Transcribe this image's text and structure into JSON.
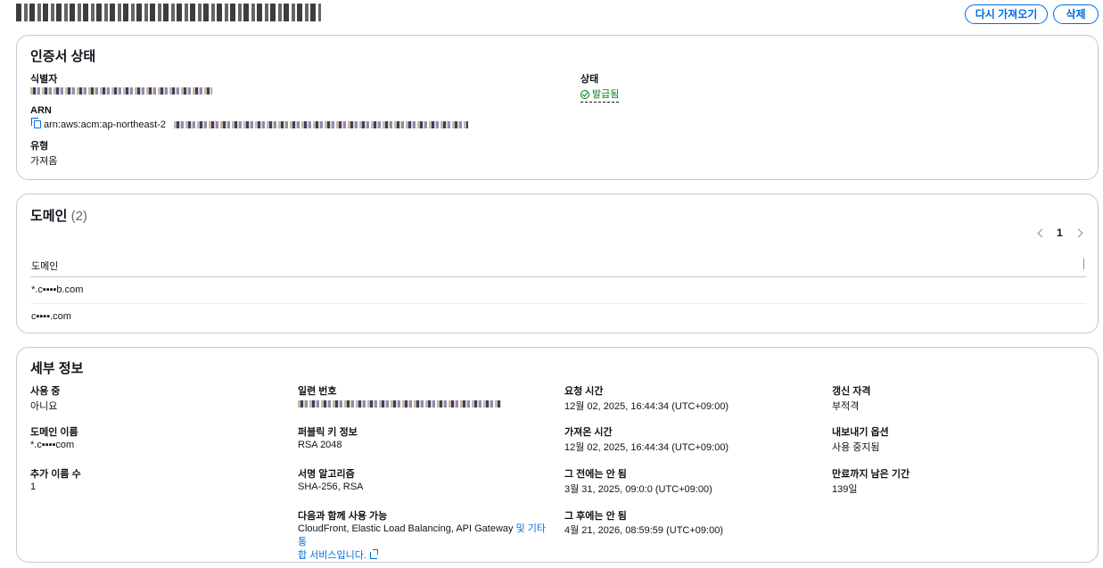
{
  "header": {
    "title": "*.c██████.com",
    "reimport_label": "다시 가져오기",
    "delete_label": "삭제"
  },
  "cert_status": {
    "title": "인증서 상태",
    "identifier_label": "식별자",
    "status_label": "상태",
    "status_value": "발급됨",
    "arn_label": "ARN",
    "arn_value": "arn:aws:acm:ap-northeast-2",
    "type_label": "유형",
    "type_value": "가져옴"
  },
  "domains": {
    "title": "도메인",
    "count": "(2)",
    "page": "1",
    "column_header": "도메인",
    "rows": [
      "*.c▪▪▪▪b.com",
      "c▪▪▪▪.com"
    ]
  },
  "details": {
    "title": "세부 정보",
    "in_use_label": "사용 중",
    "in_use_value": "아니요",
    "domain_name_label": "도메인 이름",
    "domain_name_value": "*.c▪▪▪▪com",
    "additional_names_label": "추가 이름 수",
    "additional_names_value": "1",
    "serial_label": "일련 번호",
    "public_key_label": "퍼블릭 키 정보",
    "public_key_value": "RSA 2048",
    "sig_algo_label": "서명 알고리즘",
    "sig_algo_value": "SHA-256, RSA",
    "can_use_with_label": "다음과 함께 사용 가능",
    "can_use_with_value": "CloudFront, Elastic Load Balancing, API Gateway",
    "can_use_with_link_1": "및 기타 통",
    "can_use_with_link_2": "합 서비스입니다.",
    "requested_label": "요청 시간",
    "requested_value": "12월 02, 2025, 16:44:34 (UTC+09:00)",
    "imported_label": "가져온 시간",
    "imported_value": "12월 02, 2025, 16:44:34 (UTC+09:00)",
    "not_before_label": "그 전에는 안 됨",
    "not_before_value": "3월 31, 2025, 09:0:0 (UTC+09:00)",
    "not_after_label": "그 후에는 안 됨",
    "not_after_value": "4월 21, 2026, 08:59:59 (UTC+09:00)",
    "renewal_label": "갱신 자격",
    "renewal_value": "부적격",
    "export_label": "내보내기 옵션",
    "export_value": "사용 중지됨",
    "days_left_label": "만료까지 남은 기간",
    "days_left_value": "139일"
  },
  "icons": {
    "status": "check-circle-icon",
    "copy": "copy-icon",
    "external": "external-link-icon",
    "prev": "chevron-left-icon",
    "next": "chevron-right-icon"
  }
}
